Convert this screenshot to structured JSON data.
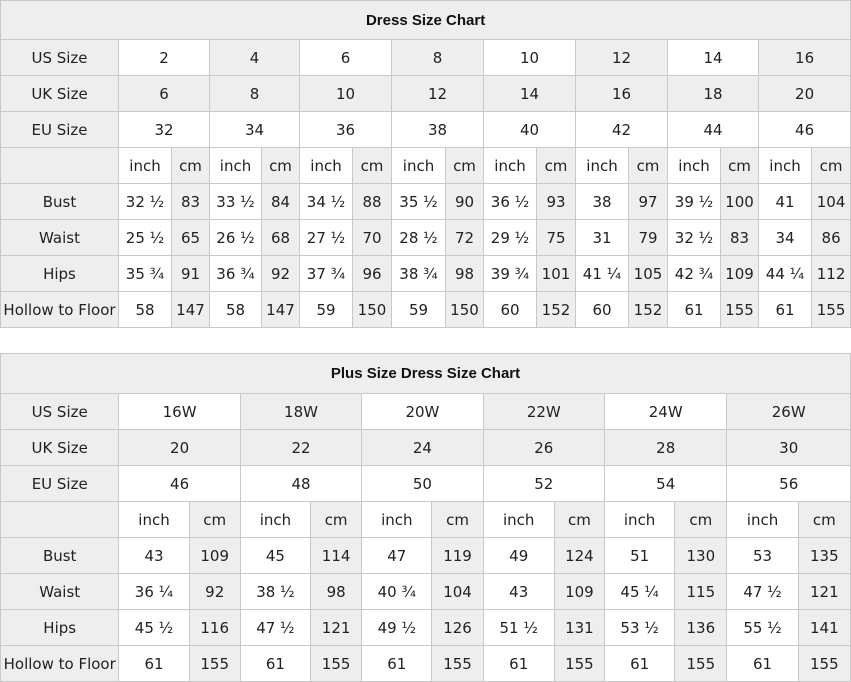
{
  "regular": {
    "title": "Dress Size Chart",
    "labels": {
      "us": "US Size",
      "uk": "UK Size",
      "eu": "EU Size",
      "unit": "",
      "bust": "Bust",
      "waist": "Waist",
      "hips": "Hips",
      "hollow": "Hollow to Floor"
    },
    "us": [
      "2",
      "4",
      "6",
      "8",
      "10",
      "12",
      "14",
      "16"
    ],
    "uk": [
      "6",
      "8",
      "10",
      "12",
      "14",
      "16",
      "18",
      "20"
    ],
    "eu": [
      "32",
      "34",
      "36",
      "38",
      "40",
      "42",
      "44",
      "46"
    ],
    "units": [
      "inch",
      "cm"
    ],
    "bust": [
      [
        "32 ½",
        "83"
      ],
      [
        "33 ½",
        "84"
      ],
      [
        "34 ½",
        "88"
      ],
      [
        "35 ½",
        "90"
      ],
      [
        "36 ½",
        "93"
      ],
      [
        "38",
        "97"
      ],
      [
        "39 ½",
        "100"
      ],
      [
        "41",
        "104"
      ]
    ],
    "waist": [
      [
        "25 ½",
        "65"
      ],
      [
        "26 ½",
        "68"
      ],
      [
        "27 ½",
        "70"
      ],
      [
        "28 ½",
        "72"
      ],
      [
        "29 ½",
        "75"
      ],
      [
        "31",
        "79"
      ],
      [
        "32 ½",
        "83"
      ],
      [
        "34",
        "86"
      ]
    ],
    "hips": [
      [
        "35 ¾",
        "91"
      ],
      [
        "36 ¾",
        "92"
      ],
      [
        "37 ¾",
        "96"
      ],
      [
        "38 ¾",
        "98"
      ],
      [
        "39 ¾",
        "101"
      ],
      [
        "41 ¼",
        "105"
      ],
      [
        "42 ¾",
        "109"
      ],
      [
        "44 ¼",
        "112"
      ]
    ],
    "hollow": [
      [
        "58",
        "147"
      ],
      [
        "58",
        "147"
      ],
      [
        "59",
        "150"
      ],
      [
        "59",
        "150"
      ],
      [
        "60",
        "152"
      ],
      [
        "60",
        "152"
      ],
      [
        "61",
        "155"
      ],
      [
        "61",
        "155"
      ]
    ]
  },
  "plus": {
    "title": "Plus Size Dress Size Chart",
    "labels": {
      "us": "US Size",
      "uk": "UK Size",
      "eu": "EU Size",
      "unit": "",
      "bust": "Bust",
      "waist": "Waist",
      "hips": "Hips",
      "hollow": "Hollow to Floor"
    },
    "us": [
      "16W",
      "18W",
      "20W",
      "22W",
      "24W",
      "26W"
    ],
    "uk": [
      "20",
      "22",
      "24",
      "26",
      "28",
      "30"
    ],
    "eu": [
      "46",
      "48",
      "50",
      "52",
      "54",
      "56"
    ],
    "units": [
      "inch",
      "cm"
    ],
    "bust": [
      [
        "43",
        "109"
      ],
      [
        "45",
        "114"
      ],
      [
        "47",
        "119"
      ],
      [
        "49",
        "124"
      ],
      [
        "51",
        "130"
      ],
      [
        "53",
        "135"
      ]
    ],
    "waist": [
      [
        "36 ¼",
        "92"
      ],
      [
        "38 ½",
        "98"
      ],
      [
        "40 ¾",
        "104"
      ],
      [
        "43",
        "109"
      ],
      [
        "45 ¼",
        "115"
      ],
      [
        "47 ½",
        "121"
      ]
    ],
    "hips": [
      [
        "45 ½",
        "116"
      ],
      [
        "47 ½",
        "121"
      ],
      [
        "49 ½",
        "126"
      ],
      [
        "51 ½",
        "131"
      ],
      [
        "53 ½",
        "136"
      ],
      [
        "55 ½",
        "141"
      ]
    ],
    "hollow": [
      [
        "61",
        "155"
      ],
      [
        "61",
        "155"
      ],
      [
        "61",
        "155"
      ],
      [
        "61",
        "155"
      ],
      [
        "61",
        "155"
      ],
      [
        "61",
        "155"
      ]
    ]
  }
}
